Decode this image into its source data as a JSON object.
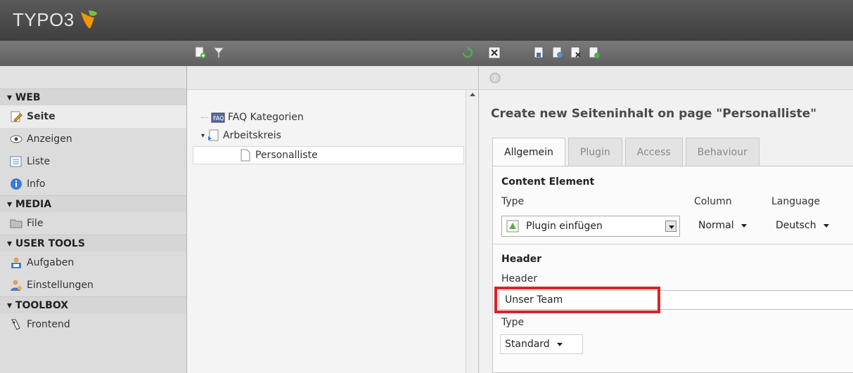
{
  "header": {
    "logo_text": "TYPO3"
  },
  "module_menu": {
    "sections": [
      {
        "label": "▾ WEB",
        "items": [
          {
            "label": "Seite",
            "icon": "page-edit-icon",
            "active": true
          },
          {
            "label": "Anzeigen",
            "icon": "eye-icon"
          },
          {
            "label": "Liste",
            "icon": "list-icon"
          },
          {
            "label": "Info",
            "icon": "info-icon"
          }
        ]
      },
      {
        "label": "▾ MEDIA",
        "items": [
          {
            "label": "File",
            "icon": "folder-icon"
          }
        ]
      },
      {
        "label": "▾ USER TOOLS",
        "items": [
          {
            "label": "Aufgaben",
            "icon": "tasks-icon"
          },
          {
            "label": "Einstellungen",
            "icon": "user-settings-icon"
          }
        ]
      },
      {
        "label": "▾ TOOLBOX",
        "items": [
          {
            "label": "Frontend",
            "icon": "frontend-icon"
          }
        ]
      }
    ]
  },
  "page_tree": {
    "items": [
      {
        "label": "FAQ Kategorien",
        "icon": "faq-folder-icon"
      },
      {
        "label": "Arbeitskreis",
        "icon": "page-folder-icon"
      },
      {
        "label": "Personalliste",
        "icon": "page-icon",
        "selected": true
      }
    ]
  },
  "content": {
    "title": "Create new Seiteninhalt on page \"Personalliste\"",
    "tabs": [
      "Allgemein",
      "Plugin",
      "Access",
      "Behaviour"
    ],
    "content_element": {
      "section_label": "Content Element",
      "type_label": "Type",
      "type_value": "Plugin einfügen",
      "column_label": "Column",
      "column_value": "Normal",
      "language_label": "Language",
      "language_value": "Deutsch"
    },
    "header": {
      "section_label": "Header",
      "header_label": "Header",
      "header_value": "Unser Team",
      "type_label": "Type",
      "type_value": "Standard"
    }
  },
  "colors": {
    "highlight": "#d9232a",
    "logo_orange": "#f49700"
  }
}
